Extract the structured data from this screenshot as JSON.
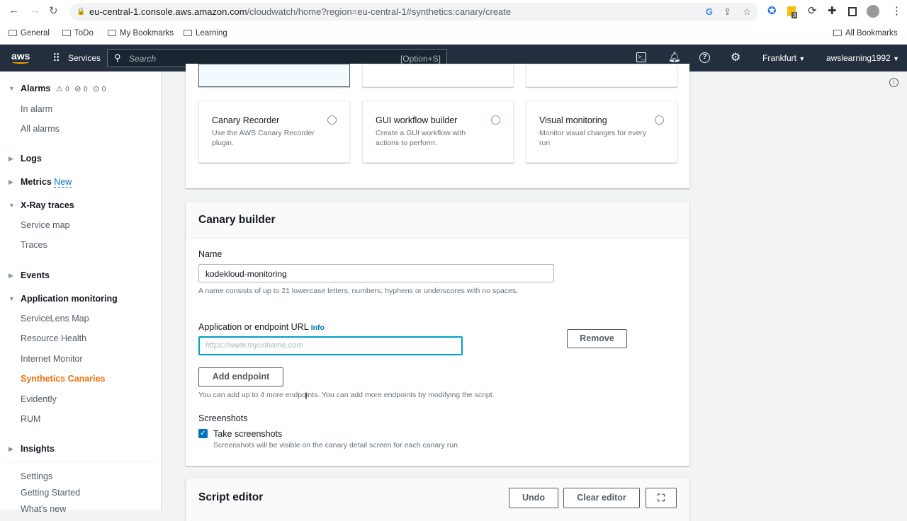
{
  "browser": {
    "url_host": "eu-central-1.console.aws.amazon.com",
    "url_path": "/cloudwatch/home?region=eu-central-1#synthetics:canary/create",
    "bookmarks": [
      "General",
      "ToDo",
      "My Bookmarks",
      "Learning"
    ],
    "all_bookmarks": "All Bookmarks",
    "ext_badge": "3"
  },
  "aws_nav": {
    "logo": "aws",
    "services": "Services",
    "search_placeholder": "Search",
    "search_shortcut": "[Option+S]",
    "region": "Frankfurt",
    "account": "awslearning1992"
  },
  "sidebar": {
    "alarms": {
      "label": "Alarms",
      "in_alarm_count": "0",
      "ok_count": "0",
      "insufficient_count": "0"
    },
    "items": [
      {
        "label": "In alarm",
        "type": "item"
      },
      {
        "label": "All alarms",
        "type": "item"
      },
      {
        "label": "Logs",
        "type": "header"
      },
      {
        "label": "Metrics",
        "type": "header",
        "badge": "New"
      },
      {
        "label": "X-Ray traces",
        "type": "header"
      },
      {
        "label": "Service map",
        "type": "item"
      },
      {
        "label": "Traces",
        "type": "item"
      },
      {
        "label": "Events",
        "type": "header"
      },
      {
        "label": "Application monitoring",
        "type": "header"
      },
      {
        "label": "ServiceLens Map",
        "type": "item"
      },
      {
        "label": "Resource Health",
        "type": "item"
      },
      {
        "label": "Internet Monitor",
        "type": "item"
      },
      {
        "label": "Synthetics Canaries",
        "type": "item",
        "active": true
      },
      {
        "label": "Evidently",
        "type": "item"
      },
      {
        "label": "RUM",
        "type": "item"
      },
      {
        "label": "Insights",
        "type": "header"
      },
      {
        "label": "Settings",
        "type": "item"
      },
      {
        "label": "Getting Started",
        "type": "item"
      },
      {
        "label": "What's new",
        "type": "item"
      }
    ]
  },
  "blueprints": [
    {
      "title": "Canary Recorder",
      "desc": "Use the AWS Canary Recorder plugin."
    },
    {
      "title": "GUI workflow builder",
      "desc": "Create a GUI workflow with actions to perform."
    },
    {
      "title": "Visual monitoring",
      "desc": "Monitor visual changes for every run"
    }
  ],
  "builder": {
    "title": "Canary builder",
    "name_label": "Name",
    "name_value": "kodekloud-monitoring",
    "name_hint": "A name consists of up to 21 lowercase letters, numbers, hyphens or underscores with no spaces.",
    "url_label": "Application or endpoint URL",
    "info": "Info",
    "url_placeholder": "https://www.myurlname.com",
    "remove": "Remove",
    "add_endpoint": "Add endpoint",
    "endpoint_hint": "You can add up to 4 more endpoints. You can add more endpoints by modifying the script.",
    "screenshots_label": "Screenshots",
    "take_screenshots": "Take screenshots",
    "screenshots_checked": true,
    "screenshots_hint": "Screenshots will be visible on the canary detail screen for each canary run"
  },
  "script_editor": {
    "title": "Script editor",
    "undo": "Undo",
    "clear": "Clear editor"
  },
  "colors": {
    "aws_nav": "#232f3e",
    "accent": "#ec7211",
    "link": "#0073bb",
    "focus": "#00a1c9"
  }
}
